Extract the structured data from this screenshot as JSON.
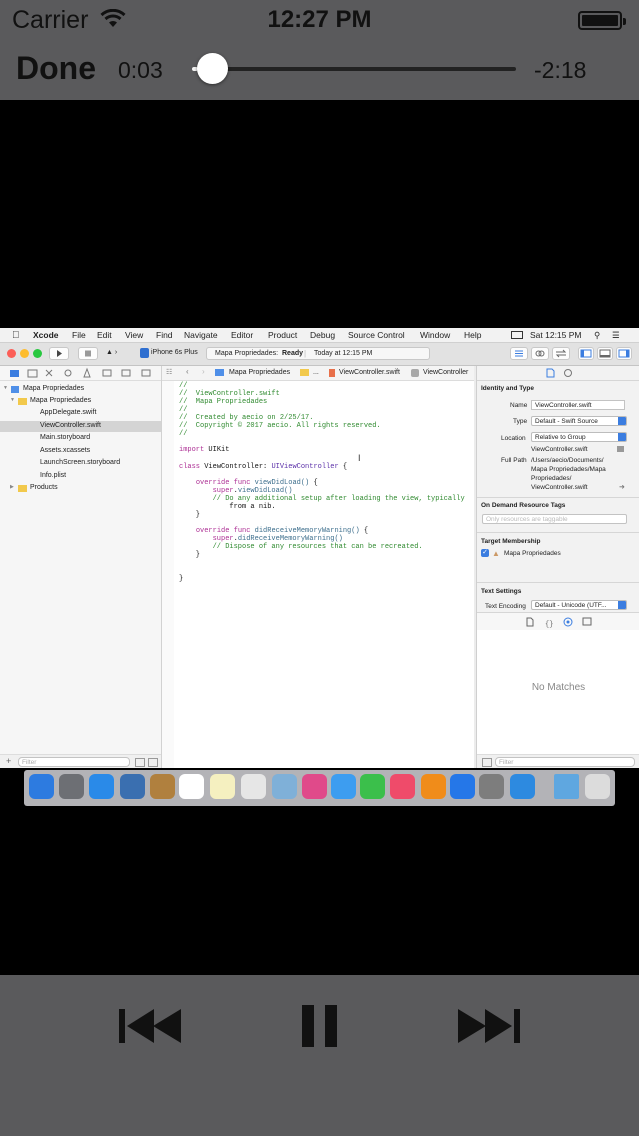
{
  "status_bar": {
    "carrier": "Carrier",
    "time": "12:27 PM"
  },
  "player": {
    "done_label": "Done",
    "elapsed": "0:03",
    "remaining": "-2:18",
    "progress_fraction": 0.02,
    "icons": [
      "wifi-icon",
      "battery-icon",
      "previous-track-icon",
      "pause-icon",
      "next-track-icon"
    ]
  },
  "mac_menu": {
    "items": [
      "Xcode",
      "File",
      "Edit",
      "View",
      "Find",
      "Navigate",
      "Editor",
      "Product",
      "Debug",
      "Source Control",
      "Window",
      "Help"
    ],
    "clock": "Sat 12:15 PM"
  },
  "xcode_toolbar": {
    "device": "iPhone 6s Plus",
    "status_project": "Mapa Propriedades:",
    "status_state": "Ready",
    "status_time": "Today at 12:15 PM"
  },
  "navigator": {
    "items": [
      {
        "label": "Mapa Propriedades",
        "indent": 0
      },
      {
        "label": "Mapa Propriedades",
        "indent": 1
      },
      {
        "label": "AppDelegate.swift",
        "indent": 2
      },
      {
        "label": "ViewController.swift",
        "indent": 2
      },
      {
        "label": "Main.storyboard",
        "indent": 2
      },
      {
        "label": "Assets.xcassets",
        "indent": 2
      },
      {
        "label": "LaunchScreen.storyboard",
        "indent": 2
      },
      {
        "label": "Info.plist",
        "indent": 2
      },
      {
        "label": "Products",
        "indent": 1
      }
    ],
    "filter_placeholder": "Filter"
  },
  "jump_bar": {
    "project": "Mapa Propriedades",
    "ellipsis": "...",
    "file": "ViewController.swift",
    "symbol": "ViewController"
  },
  "code_lines": [
    "//",
    "//  ViewController.swift",
    "//  Mapa Propriedades",
    "//",
    "//  Created by aecio on 2/25/17.",
    "//  Copyright © 2017 aecio. All rights reserved.",
    "//",
    "",
    "import UIKit",
    "",
    "class ViewController: UIViewController {",
    "",
    "    override func viewDidLoad() {",
    "        super.viewDidLoad()",
    "        // Do any additional setup after loading the view, typically",
    "            from a nib.",
    "    }",
    "",
    "    override func didReceiveMemoryWarning() {",
    "        super.didReceiveMemoryWarning()",
    "        // Dispose of any resources that can be recreated.",
    "    }",
    "",
    "",
    "}"
  ],
  "inspector": {
    "identity_title": "Identity and Type",
    "name_label": "Name",
    "name_value": "ViewController.swift",
    "type_label": "Type",
    "type_value": "Default - Swift Source",
    "location_label": "Location",
    "location_value": "Relative to Group",
    "location_file": "ViewController.swift",
    "full_path_label": "Full Path",
    "full_path_lines": [
      "/Users/aecio/Documents/",
      "Mapa Propriedades/Mapa",
      "Propriedades/",
      "ViewController.swift"
    ],
    "odr_title": "On Demand Resource Tags",
    "odr_placeholder": "Only resources are taggable",
    "target_title": "Target Membership",
    "target_item": "Mapa Propriedades",
    "text_settings_title": "Text Settings",
    "encoding_label": "Text Encoding",
    "encoding_value": "Default - Unicode (UTF...",
    "no_matches": "No Matches",
    "filter_placeholder": "Filter"
  },
  "dock_icon_colors": [
    "#2d7be0",
    "#6d6f74",
    "#2a8ae8",
    "#3a6fb0",
    "#b0803e",
    "#ffffff",
    "#f5f0c0",
    "#e6e6e6",
    "#7fb0d8",
    "#e04a8a",
    "#3d9df0",
    "#3bbf4b",
    "#ef4b6a",
    "#f08c1a",
    "#2577e8",
    "#7d7d7d",
    "#2d8ae0",
    "#5fa7e0",
    "#dcdcdc"
  ]
}
